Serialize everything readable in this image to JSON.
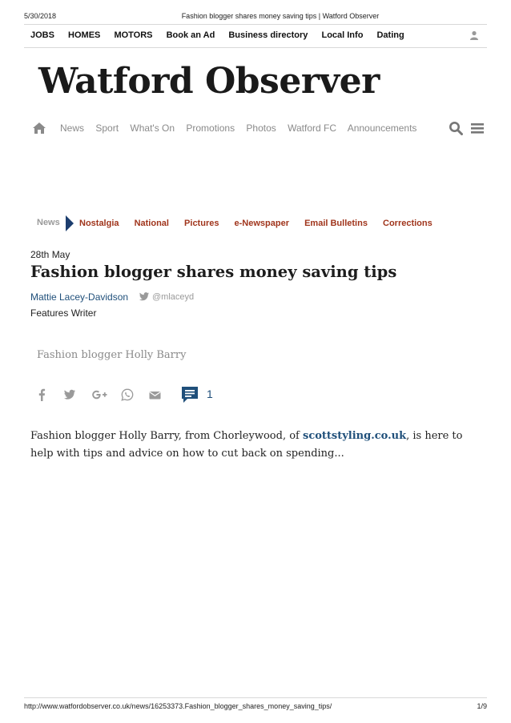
{
  "print_header": {
    "date": "5/30/2018",
    "title": "Fashion blogger shares money saving tips | Watford Observer"
  },
  "top_links": [
    "JOBS",
    "HOMES",
    "MOTORS",
    "Book an Ad",
    "Business directory",
    "Local Info",
    "Dating"
  ],
  "logo_text": "Watford Observer",
  "main_nav": [
    "News",
    "Sport",
    "What's On",
    "Promotions",
    "Photos",
    "Watford FC",
    "Announcements"
  ],
  "section": "News",
  "sub_nav": [
    "Nostalgia",
    "National",
    "Pictures",
    "e-Newspaper",
    "Email Bulletins",
    "Corrections"
  ],
  "article": {
    "date": "28th May",
    "headline": "Fashion blogger shares money saving tips",
    "author": "Mattie Lacey-Davidson",
    "twitter_handle": "@mlaceyd",
    "author_role": "Features Writer",
    "image_caption": "Fashion blogger Holly Barry",
    "comment_count": "1",
    "body_before_link": "Fashion blogger Holly Barry, from Chorleywood, of ",
    "body_link": "scottstyling.co.uk",
    "body_after_link": ", is here to help with tips and advice on how to cut back on spending..."
  },
  "print_footer": {
    "url": "http://www.watfordobserver.co.uk/news/16253373.Fashion_blogger_shares_money_saving_tips/",
    "page": "1/9"
  },
  "icons": {
    "user": "user-icon",
    "home": "home-icon",
    "search": "search-icon",
    "menu": "menu-icon",
    "arrow": "chevron-right-icon",
    "twitter": "twitter-icon",
    "share": [
      "facebook-icon",
      "twitter-icon",
      "google-plus-icon",
      "whatsapp-icon",
      "email-icon",
      "comment-icon"
    ]
  },
  "colors": {
    "link_blue": "#1f4f7a",
    "category_red": "#a0351c",
    "nav_grey": "#8a8a8a",
    "arrow_navy": "#1c3d6e"
  }
}
